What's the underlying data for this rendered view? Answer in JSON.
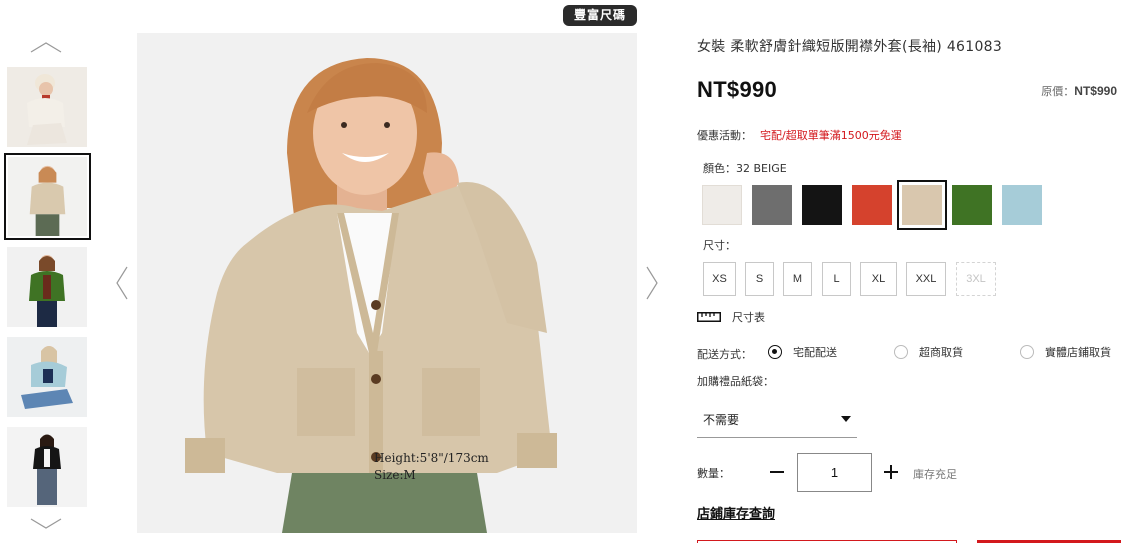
{
  "badge": "豐富尺碼",
  "main_image": {
    "model_height": "Height:5'8\"/173cm",
    "model_size": "Size:M"
  },
  "thumbnails": [
    {
      "name": "thumb-look-1"
    },
    {
      "name": "thumb-look-2"
    },
    {
      "name": "thumb-look-3"
    },
    {
      "name": "thumb-look-4"
    },
    {
      "name": "thumb-look-5"
    }
  ],
  "product": {
    "title": "女裝 柔軟舒膚針織短版開襟外套(長袖) 461083",
    "price": "NT$990",
    "original_price_label": "原價：",
    "original_price": "NT$990",
    "promo_label": "優惠活動：",
    "promo_text": "宅配/超取單筆滿1500元免運",
    "color_label": "顏色：32 BEIGE",
    "colors": [
      "#efece8",
      "#6e6e6e",
      "#141414",
      "#d5422d",
      "#d9c7ae",
      "#3f7324",
      "#a6ccd8"
    ],
    "size_label": "尺寸：",
    "sizes": [
      "XS",
      "S",
      "M",
      "L",
      "XL",
      "XXL",
      "3XL"
    ],
    "size_chart_label": "尺寸表",
    "shipping_label": "配送方式：",
    "shipping_options": [
      "宅配配送",
      "超商取貨",
      "實體店鋪取貨"
    ],
    "bag_label": "加購禮品紙袋：",
    "bag_value": "不需要",
    "qty_label": "數量：",
    "qty_value": "1",
    "stock_text": "庫存充足",
    "store_link": "店鋪庫存查詢"
  },
  "colors": {
    "accent": "#d3181d",
    "text": "#222222"
  }
}
